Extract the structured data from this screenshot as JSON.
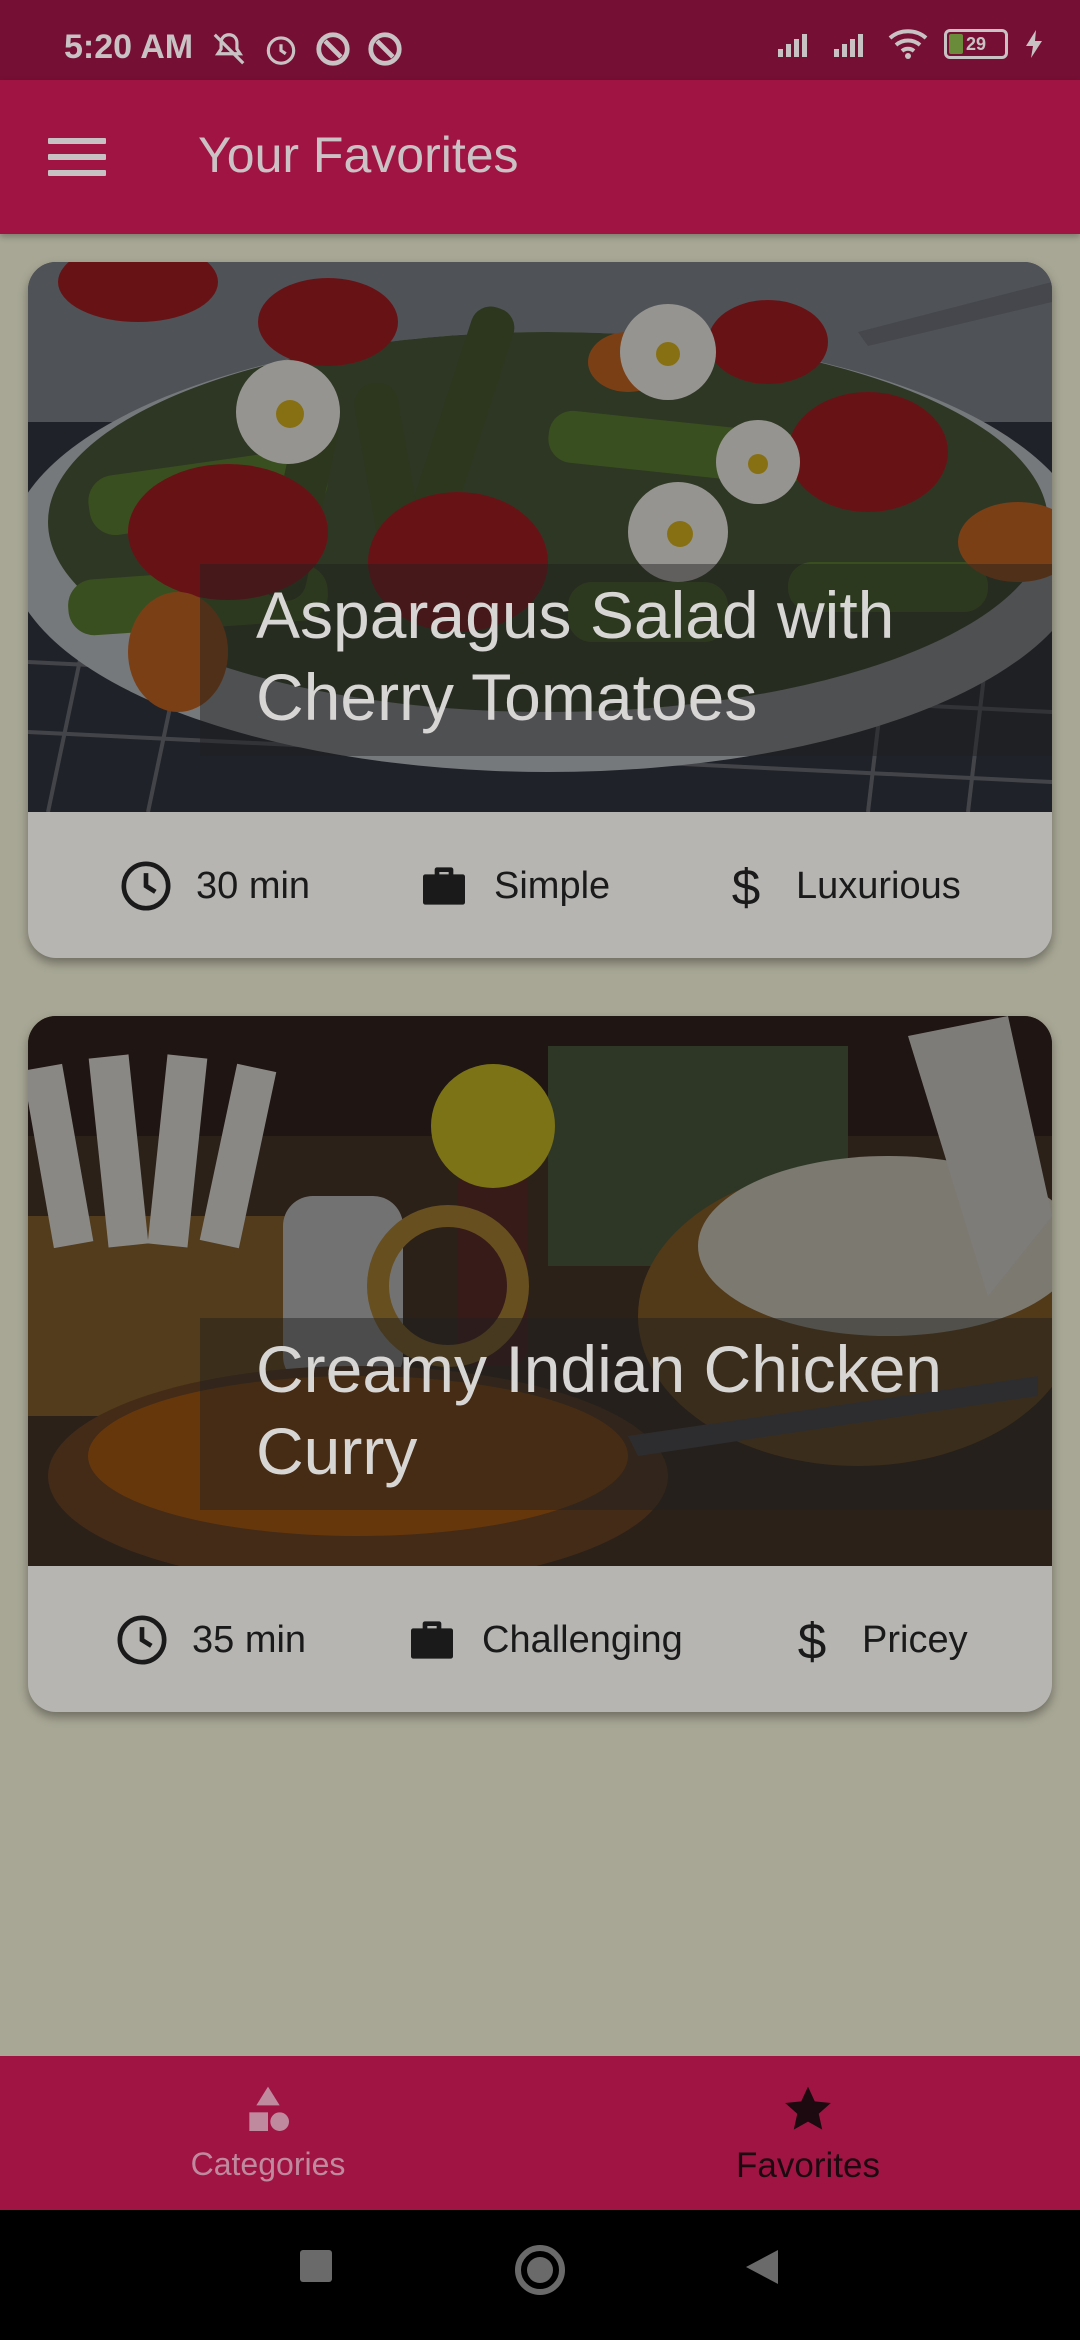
{
  "status_bar": {
    "time": "5:20 AM",
    "battery": "29",
    "icons_left": [
      "mute-icon",
      "alarm-icon",
      "do-not-disturb-icon",
      "do-not-disturb-icon"
    ],
    "icons_right": [
      "signal-icon",
      "signal-icon",
      "wifi-icon",
      "battery-icon",
      "charging-icon"
    ]
  },
  "app_bar": {
    "title": "Your Favorites",
    "menu_icon": "hamburger-menu-icon"
  },
  "meals": [
    {
      "title": "Asparagus Salad with Cherry Tomatoes",
      "duration": "30 min",
      "complexity": "Simple",
      "affordability": "Luxurious"
    },
    {
      "title": "Creamy Indian Chicken Curry",
      "duration": "35 min",
      "complexity": "Challenging",
      "affordability": "Pricey"
    }
  ],
  "bottom_nav": {
    "items": [
      {
        "label": "Categories",
        "icon": "category-shapes-icon",
        "selected": false
      },
      {
        "label": "Favorites",
        "icon": "star-icon",
        "selected": true
      }
    ]
  },
  "colors": {
    "primary": "#a01444",
    "status_bar": "#750f34",
    "background": "#a8a795",
    "card": "#b6b5b1"
  }
}
